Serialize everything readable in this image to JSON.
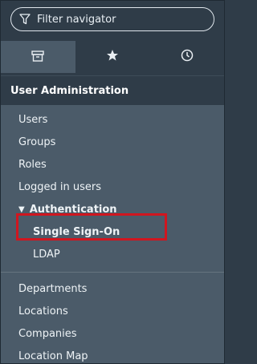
{
  "filter": {
    "placeholder": "Filter navigator"
  },
  "tabs": [
    {
      "icon": "archive-icon",
      "active": true
    },
    {
      "icon": "star-icon",
      "active": false
    },
    {
      "icon": "clock-icon",
      "active": false
    }
  ],
  "section": {
    "title": "User Administration"
  },
  "items": {
    "users": "Users",
    "groups": "Groups",
    "roles": "Roles",
    "logged_in": "Logged in users",
    "authentication": "Authentication",
    "single_sign_on": "Single Sign-On",
    "ldap": "LDAP",
    "departments": "Departments",
    "locations": "Locations",
    "companies": "Companies",
    "location_map": "Location Map"
  },
  "colors": {
    "panel_bg": "#4b5b69",
    "header_bg": "#2f3c48",
    "highlight": "#d0161f"
  }
}
